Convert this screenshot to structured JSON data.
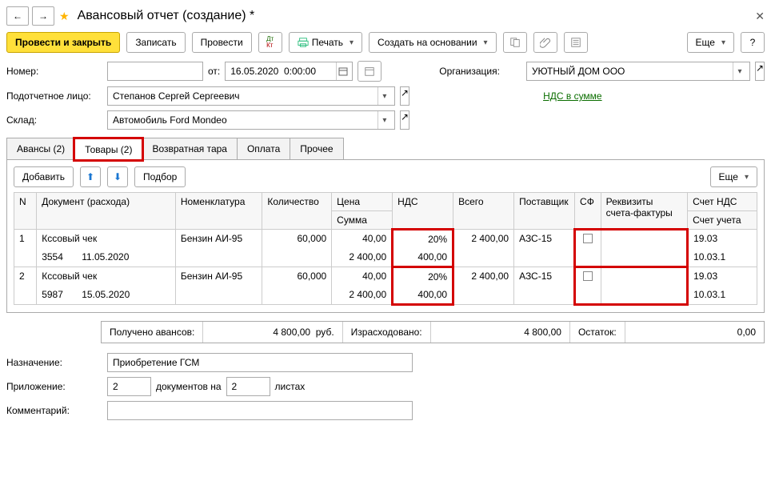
{
  "header": {
    "title": "Авансовый отчет (создание) *"
  },
  "toolbar": {
    "post_close": "Провести и закрыть",
    "write": "Записать",
    "post": "Провести",
    "print": "Печать",
    "create_based": "Создать на основании",
    "more": "Еще",
    "help": "?"
  },
  "fields": {
    "number_label": "Номер:",
    "number": "",
    "from_label": "от:",
    "date": "16.05.2020  0:00:00",
    "org_label": "Организация:",
    "org": "УЮТНЫЙ ДОМ ООО",
    "person_label": "Подотчетное лицо:",
    "person": "Степанов Сергей Сергеевич",
    "vat_link": "НДС в сумме",
    "warehouse_label": "Склад:",
    "warehouse": "Автомобиль Ford Mondeo"
  },
  "tabs": {
    "advances": "Авансы (2)",
    "goods": "Товары (2)",
    "tare": "Возвратная тара",
    "payment": "Оплата",
    "other": "Прочее"
  },
  "tbl_toolbar": {
    "add": "Добавить",
    "pick": "Подбор",
    "more": "Еще"
  },
  "columns": {
    "n": "N",
    "doc": "Документ (расхода)",
    "nomen": "Номенклатура",
    "qty": "Количество",
    "price": "Цена",
    "sum": "Сумма",
    "vat": "НДС",
    "total": "Всего",
    "supplier": "Поставщик",
    "sf": "СФ",
    "sf_details": "Реквизиты счета-фактуры",
    "acct_vat": "Счет НДС",
    "acct": "Счет учета"
  },
  "rows": [
    {
      "n": "1",
      "doc_type": "Кссовый чек",
      "doc_num": "3554",
      "doc_date": "11.05.2020",
      "nomen": "Бензин АИ-95",
      "qty": "60,000",
      "price": "40,00",
      "sum": "2 400,00",
      "vat_rate": "20%",
      "vat_amt": "400,00",
      "total": "2 400,00",
      "supplier": "АЗС-15",
      "acct_vat": "19.03",
      "acct": "10.03.1"
    },
    {
      "n": "2",
      "doc_type": "Кссовый чек",
      "doc_num": "5987",
      "doc_date": "15.05.2020",
      "nomen": "Бензин АИ-95",
      "qty": "60,000",
      "price": "40,00",
      "sum": "2 400,00",
      "vat_rate": "20%",
      "vat_amt": "400,00",
      "total": "2 400,00",
      "supplier": "АЗС-15",
      "acct_vat": "19.03",
      "acct": "10.03.1"
    }
  ],
  "summary": {
    "adv_label": "Получено авансов:",
    "adv_amt": "4 800,00",
    "currency": "руб.",
    "spent_label": "Израсходовано:",
    "spent_amt": "4 800,00",
    "balance_label": "Остаток:",
    "balance_amt": "0,00"
  },
  "footer": {
    "purpose_label": "Назначение:",
    "purpose": "Приобретение ГСМ",
    "attach_label": "Приложение:",
    "attach_count": "2",
    "attach_mid": "документов на",
    "attach_pages": "2",
    "attach_end": "листах",
    "comment_label": "Комментарий:",
    "comment": ""
  }
}
